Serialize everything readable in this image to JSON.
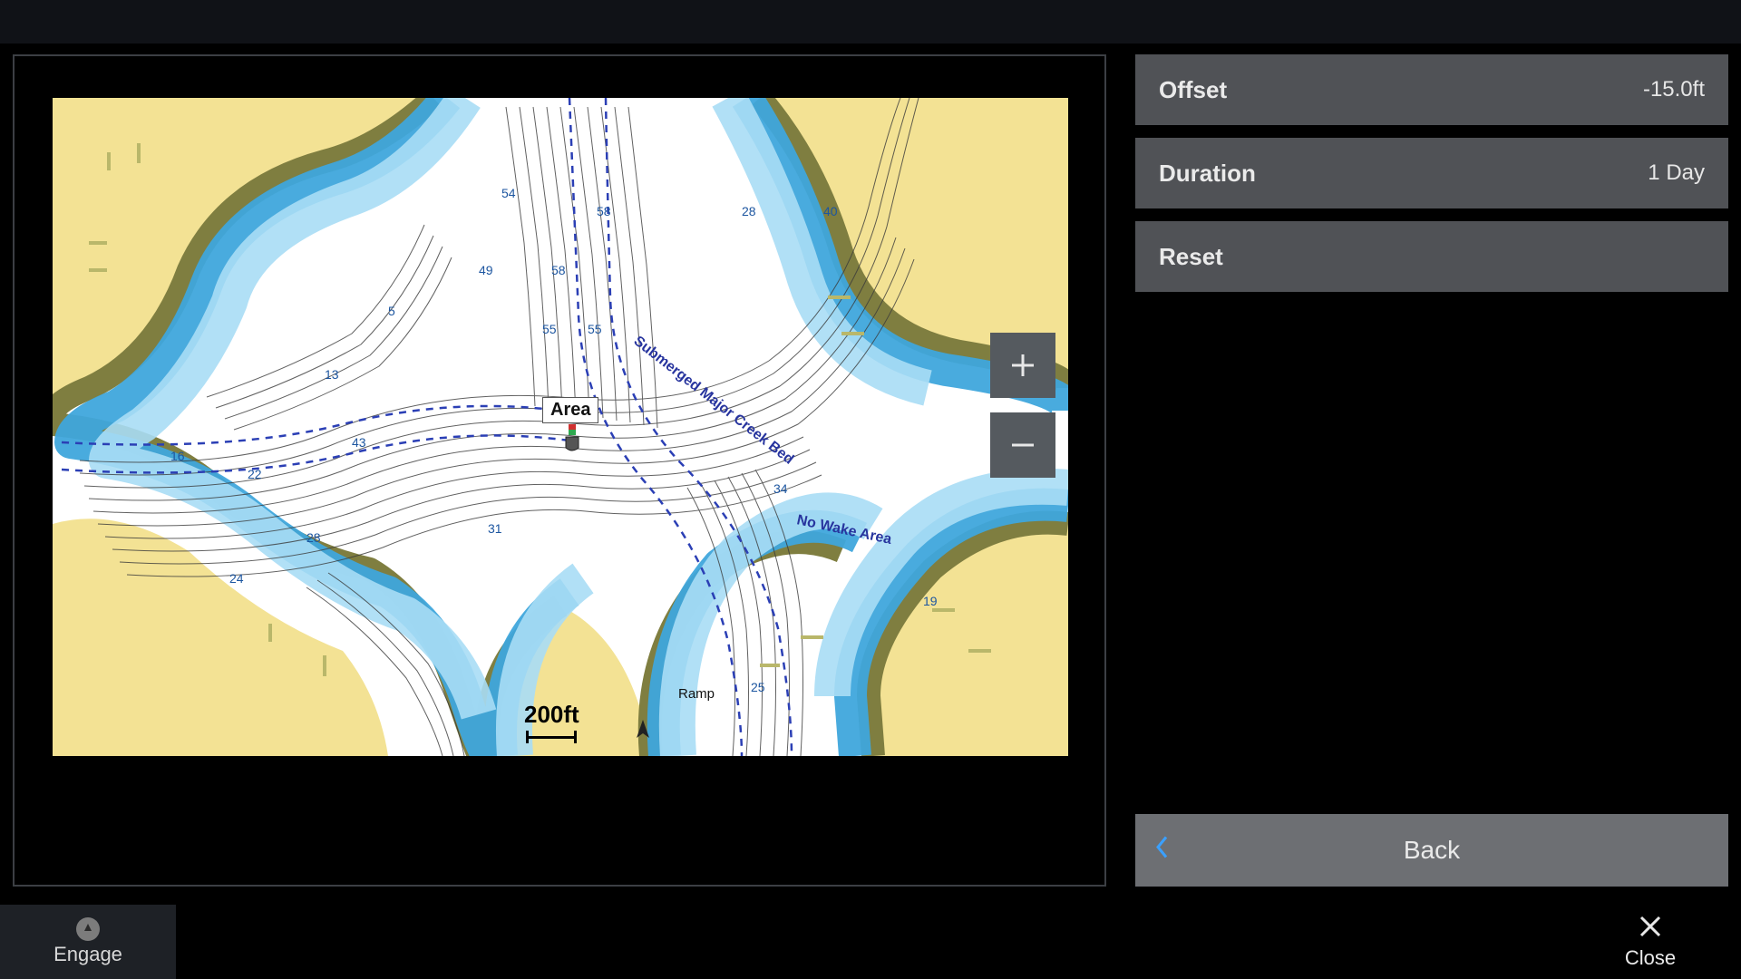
{
  "menu": {
    "offset": {
      "label": "Offset",
      "value": "-15.0ft"
    },
    "duration": {
      "label": "Duration",
      "value": "1 Day"
    },
    "reset": {
      "label": "Reset"
    },
    "back": {
      "label": "Back"
    }
  },
  "map": {
    "area_label": "Area",
    "scale": "200ft",
    "annotations": {
      "creek_bed": "Submerged Major Creek Bed",
      "no_wake": "No Wake Area",
      "ramp": "Ramp"
    },
    "depth_numbers": [
      "5",
      "13",
      "16",
      "19",
      "22",
      "24",
      "25",
      "28",
      "28",
      "31",
      "34",
      "40",
      "43",
      "55",
      "55",
      "58",
      "58",
      "49",
      "54"
    ]
  },
  "bottombar": {
    "engage": "Engage",
    "close": "Close"
  },
  "zoom": {
    "in": "+",
    "out": "−"
  }
}
